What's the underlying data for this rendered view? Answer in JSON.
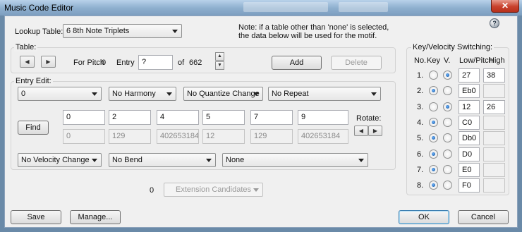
{
  "window": {
    "title": "Music Code Editor",
    "close_symbol": "✕"
  },
  "lookup": {
    "label": "Lookup Table:",
    "value": "6 8th Note Triplets"
  },
  "note": {
    "line1": "Note: if a table other than 'none' is selected,",
    "line2": "the data below will be used for the motif."
  },
  "table_group": {
    "label": "Table:",
    "prev_symbol": "◀",
    "next_symbol": "▶",
    "for_pitch_label": "For Pitch",
    "for_pitch_value": "0",
    "entry_label": "Entry",
    "entry_value": "?",
    "of_label": "of",
    "of_value": "662",
    "spin_up": "▲",
    "spin_down": "▼",
    "add_label": "Add",
    "delete_label": "Delete"
  },
  "entry_edit": {
    "label": "Entry Edit:",
    "dropdowns_top": [
      "0",
      "No Harmony",
      "No Quantize Change",
      "No Repeat"
    ],
    "find_label": "Find",
    "values": [
      "0",
      "2",
      "4",
      "5",
      "7",
      "9"
    ],
    "derived": [
      "0",
      "129",
      "402653184",
      "12",
      "129",
      "402653184"
    ],
    "rotate_label": "Rotate:",
    "rotate_left": "◀",
    "rotate_right": "▶",
    "dropdowns_bottom": [
      "No Velocity Change",
      "No Bend",
      "None"
    ]
  },
  "extension": {
    "count": "0",
    "label": "Extension Candidates"
  },
  "key_velocity": {
    "label": "Key/Velocity Switching:",
    "headers": {
      "no": "No.",
      "key": "Key",
      "v": "V.",
      "low": "Low/Pitch",
      "high": "High"
    },
    "rows": [
      {
        "no": "1.",
        "key": false,
        "v": true,
        "low": "27",
        "high": "38"
      },
      {
        "no": "2.",
        "key": true,
        "v": false,
        "low": "Eb0",
        "high": ""
      },
      {
        "no": "3.",
        "key": false,
        "v": true,
        "low": "12",
        "high": "26"
      },
      {
        "no": "4.",
        "key": true,
        "v": false,
        "low": "C0",
        "high": ""
      },
      {
        "no": "5.",
        "key": true,
        "v": false,
        "low": "Db0",
        "high": ""
      },
      {
        "no": "6.",
        "key": true,
        "v": false,
        "low": "D0",
        "high": ""
      },
      {
        "no": "7.",
        "key": true,
        "v": false,
        "low": "E0",
        "high": ""
      },
      {
        "no": "8.",
        "key": true,
        "v": false,
        "low": "F0",
        "high": ""
      }
    ]
  },
  "footer": {
    "save": "Save",
    "manage": "Manage...",
    "ok": "OK",
    "cancel": "Cancel"
  },
  "help_symbol": "?"
}
